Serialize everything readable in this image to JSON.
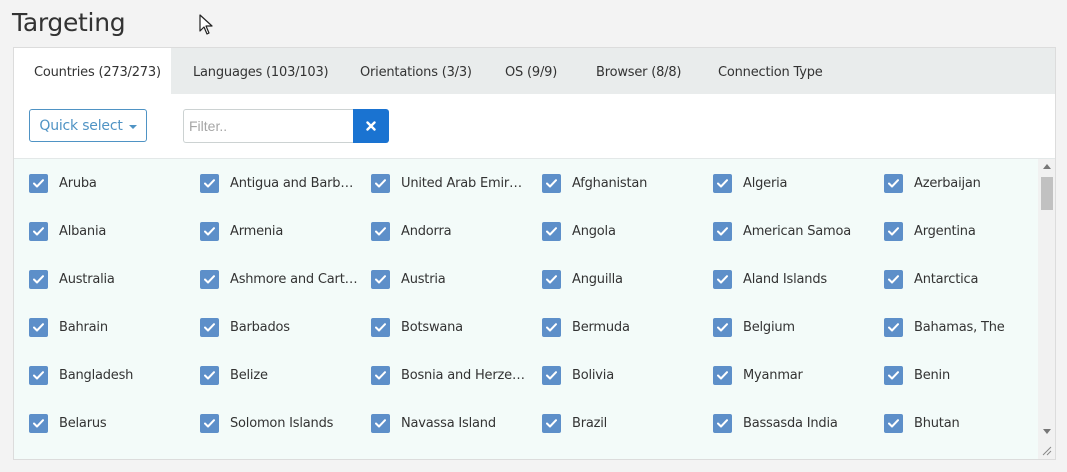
{
  "page": {
    "title": "Targeting"
  },
  "tabs": [
    {
      "label": "Countries (273/273)",
      "active": true
    },
    {
      "label": "Languages (103/103)",
      "active": false
    },
    {
      "label": "Orientations (3/3)",
      "active": false
    },
    {
      "label": "OS (9/9)",
      "active": false
    },
    {
      "label": "Browser (8/8)",
      "active": false
    },
    {
      "label": "Connection Type",
      "active": false
    }
  ],
  "toolbar": {
    "quick_select_label": "Quick select",
    "filter_placeholder": "Filter..",
    "filter_value": ""
  },
  "colors": {
    "accent": "#4f93c4",
    "clear_button": "#1a73d1",
    "checkbox": "#5d8fc9",
    "list_background": "#f3fbf9"
  },
  "icons": {
    "dropdown": "caret-down-icon",
    "clear": "x-icon",
    "checkbox": "checkmark-icon",
    "cursor": "mouse-pointer-icon"
  },
  "countries": [
    {
      "label": "Aruba",
      "checked": true
    },
    {
      "label": "Antigua and Barbuda",
      "checked": true
    },
    {
      "label": "United Arab Emirates",
      "checked": true
    },
    {
      "label": "Afghanistan",
      "checked": true
    },
    {
      "label": "Algeria",
      "checked": true
    },
    {
      "label": "Azerbaijan",
      "checked": true
    },
    {
      "label": "Albania",
      "checked": true
    },
    {
      "label": "Armenia",
      "checked": true
    },
    {
      "label": "Andorra",
      "checked": true
    },
    {
      "label": "Angola",
      "checked": true
    },
    {
      "label": "American Samoa",
      "checked": true
    },
    {
      "label": "Argentina",
      "checked": true
    },
    {
      "label": "Australia",
      "checked": true
    },
    {
      "label": "Ashmore and Cartier Islands",
      "checked": true
    },
    {
      "label": "Austria",
      "checked": true
    },
    {
      "label": "Anguilla",
      "checked": true
    },
    {
      "label": "Aland Islands",
      "checked": true
    },
    {
      "label": "Antarctica",
      "checked": true
    },
    {
      "label": "Bahrain",
      "checked": true
    },
    {
      "label": "Barbados",
      "checked": true
    },
    {
      "label": "Botswana",
      "checked": true
    },
    {
      "label": "Bermuda",
      "checked": true
    },
    {
      "label": "Belgium",
      "checked": true
    },
    {
      "label": "Bahamas, The",
      "checked": true
    },
    {
      "label": "Bangladesh",
      "checked": true
    },
    {
      "label": "Belize",
      "checked": true
    },
    {
      "label": "Bosnia and Herzegovina",
      "checked": true
    },
    {
      "label": "Bolivia",
      "checked": true
    },
    {
      "label": "Myanmar",
      "checked": true
    },
    {
      "label": "Benin",
      "checked": true
    },
    {
      "label": "Belarus",
      "checked": true
    },
    {
      "label": "Solomon Islands",
      "checked": true
    },
    {
      "label": "Navassa Island",
      "checked": true
    },
    {
      "label": "Brazil",
      "checked": true
    },
    {
      "label": "Bassasda India",
      "checked": true
    },
    {
      "label": "Bhutan",
      "checked": true
    }
  ]
}
